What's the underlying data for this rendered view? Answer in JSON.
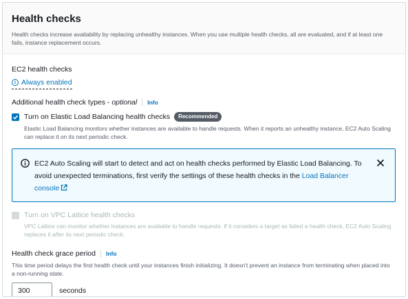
{
  "header": {
    "title": "Health checks",
    "description": "Health checks increase availability by replacing unhealthy instances. When you use multiple health checks, all are evaluated, and if at least one fails, instance replacement occurs."
  },
  "ec2": {
    "label": "EC2 health checks",
    "status": "Always enabled",
    "status_icon": "info-icon"
  },
  "additional": {
    "label": "Additional health check types - ",
    "optional": "optional",
    "info": "Info"
  },
  "elb": {
    "checked": true,
    "label": "Turn on Elastic Load Balancing health checks",
    "badge": "Recommended",
    "description": "Elastic Load Balancing monitors whether instances are available to handle requests. When it reports an unhealthy instance, EC2 Auto Scaling can replace it on its next periodic check."
  },
  "alert": {
    "text": "EC2 Auto Scaling will start to detect and act on health checks performed by Elastic Load Balancing. To avoid unexpected terminations, first verify the settings of these health checks in the ",
    "link": "Load Balancer console",
    "close_icon": "close-icon",
    "accent": "#0073bb"
  },
  "vpc": {
    "checked": false,
    "disabled": true,
    "label": "Turn on VPC Lattice health checks",
    "description": "VPC Lattice can monitor whether instances are available to handle requests. If it considers a target as failed a health check, EC2 Auto Scaling replaces it after its next periodic check."
  },
  "grace": {
    "label": "Health check grace period",
    "info": "Info",
    "description": "This time period delays the first health check until your instances finish initializing. It doesn't prevent an instance from terminating when placed into a non-running state.",
    "value": "300",
    "unit": "seconds"
  }
}
